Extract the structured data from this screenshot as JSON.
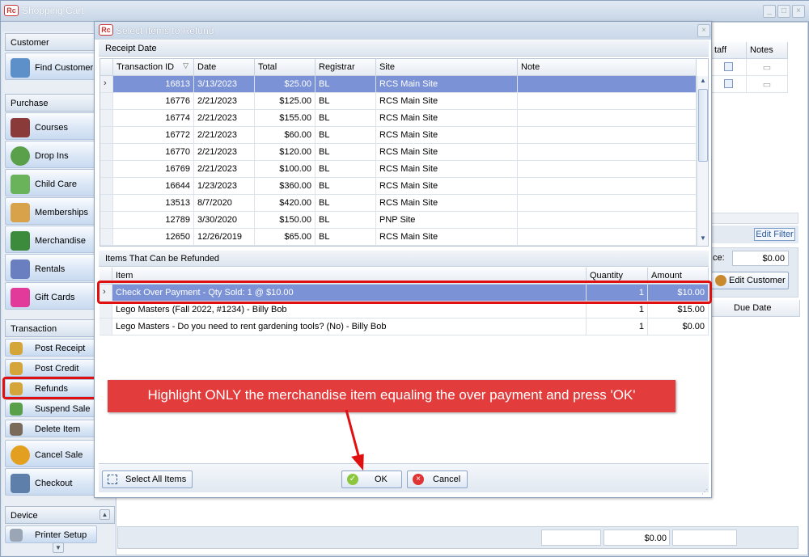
{
  "window": {
    "title": "Shopping Cart",
    "logo": "Rc"
  },
  "sidebar": {
    "customer_header": "Customer",
    "find_customer": "Find Customer",
    "purchase_header": "Purchase",
    "purchase_items": [
      "Courses",
      "Drop Ins",
      "Child Care",
      "Memberships",
      "Merchandise",
      "Rentals",
      "Gift Cards"
    ],
    "transaction_header": "Transaction",
    "transaction_items": [
      "Post Receipt",
      "Post Credit",
      "Refunds",
      "Suspend Sale",
      "Delete Item",
      "Cancel Sale",
      "Checkout"
    ],
    "device_header": "Device",
    "printer_setup": "Printer Setup"
  },
  "background": {
    "col_staff": "taff",
    "col_notes": "Notes",
    "edit_filter": "Edit Filter",
    "balance_label": "ce:",
    "balance_value": "$0.00",
    "edit_customer": "Edit Customer",
    "due_date": "Due Date",
    "footer_total": "$0.00"
  },
  "dialog": {
    "title": "Select Items to Refund",
    "receipt_group": "Receipt Date",
    "receipt_columns": [
      "Transaction ID",
      "Date",
      "Total",
      "Registrar",
      "Site",
      "Note"
    ],
    "receipts": [
      {
        "id": "16813",
        "date": "3/13/2023",
        "total": "$25.00",
        "registrar": "BL",
        "site": "RCS Main Site",
        "note": ""
      },
      {
        "id": "16776",
        "date": "2/21/2023",
        "total": "$125.00",
        "registrar": "BL",
        "site": "RCS Main Site",
        "note": ""
      },
      {
        "id": "16774",
        "date": "2/21/2023",
        "total": "$155.00",
        "registrar": "BL",
        "site": "RCS Main Site",
        "note": ""
      },
      {
        "id": "16772",
        "date": "2/21/2023",
        "total": "$60.00",
        "registrar": "BL",
        "site": "RCS Main Site",
        "note": ""
      },
      {
        "id": "16770",
        "date": "2/21/2023",
        "total": "$120.00",
        "registrar": "BL",
        "site": "RCS Main Site",
        "note": ""
      },
      {
        "id": "16769",
        "date": "2/21/2023",
        "total": "$100.00",
        "registrar": "BL",
        "site": "RCS Main Site",
        "note": ""
      },
      {
        "id": "16644",
        "date": "1/23/2023",
        "total": "$360.00",
        "registrar": "BL",
        "site": "RCS Main Site",
        "note": ""
      },
      {
        "id": "13513",
        "date": "8/7/2020",
        "total": "$420.00",
        "registrar": "BL",
        "site": "RCS Main Site",
        "note": ""
      },
      {
        "id": "12789",
        "date": "3/30/2020",
        "total": "$150.00",
        "registrar": "BL",
        "site": "PNP Site",
        "note": ""
      },
      {
        "id": "12650",
        "date": "12/26/2019",
        "total": "$65.00",
        "registrar": "BL",
        "site": "RCS Main Site",
        "note": ""
      }
    ],
    "items_group": "Items That Can be Refunded",
    "item_columns": [
      "Item",
      "Quantity",
      "Amount"
    ],
    "items": [
      {
        "item": "Check Over Payment - Qty Sold: 1 @ $10.00",
        "qty": "1",
        "amount": "$10.00"
      },
      {
        "item": "Lego Masters (Fall 2022, #1234) - Billy Bob",
        "qty": "1",
        "amount": "$15.00"
      },
      {
        "item": "Lego Masters - Do you need to rent gardening tools? (No) - Billy Bob",
        "qty": "1",
        "amount": "$0.00"
      }
    ],
    "select_all": "Select All Items",
    "ok": "OK",
    "cancel": "Cancel"
  },
  "annotation": {
    "text": "Highlight ONLY the merchandise item equaling the over payment and press 'OK'",
    "color": "#e23c3c"
  }
}
